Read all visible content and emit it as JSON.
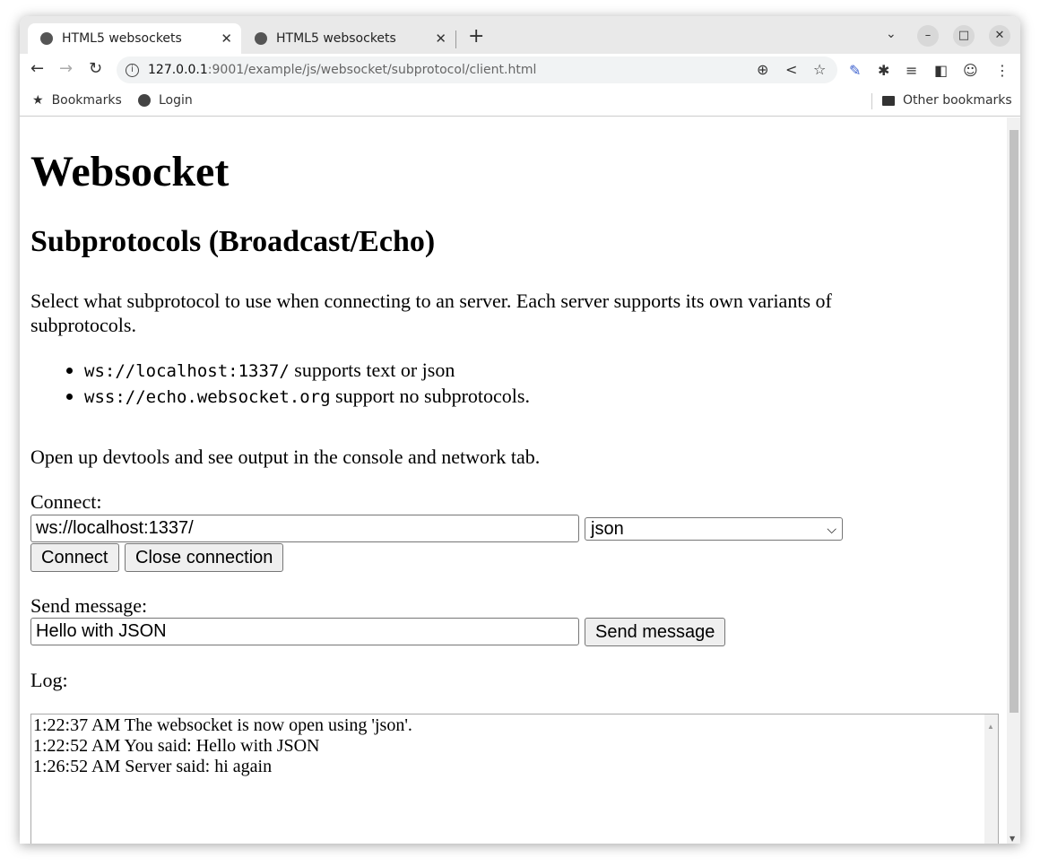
{
  "browser": {
    "tabs": [
      {
        "title": "HTML5 websockets",
        "active": true
      },
      {
        "title": "HTML5 websockets",
        "active": false
      }
    ],
    "url_host": "127.0.0.1",
    "url_rest": ":9001/example/js/websocket/subprotocol/client.html",
    "bookmarks": [
      {
        "label": "Bookmarks",
        "icon": "star-icon"
      },
      {
        "label": "Login",
        "icon": "globe-icon"
      }
    ],
    "other_bookmarks": "Other bookmarks"
  },
  "page": {
    "title": "Websocket",
    "subtitle": "Subprotocols (Broadcast/Echo)",
    "intro": "Select what subprotocol to use when connecting to an server. Each server supports its own variants of subprotocols.",
    "servers": [
      {
        "url": "ws://localhost:1337/",
        "desc": " supports text or json"
      },
      {
        "url": "wss://echo.websocket.org",
        "desc": " support no subprotocols."
      }
    ],
    "devtools_note": "Open up devtools and see output in the console and network tab.",
    "connect_label": "Connect:",
    "connect_url": "ws://localhost:1337/",
    "protocol_selected": "json",
    "connect_button": "Connect",
    "close_button": "Close connection",
    "send_label": "Send message:",
    "message_value": "Hello with JSON",
    "send_button": "Send message",
    "log_label": "Log:",
    "log_lines": [
      "1:22:37 AM The websocket is now open using 'json'.",
      "1:22:52 AM You said: Hello with JSON",
      "1:26:52 AM Server said: hi again"
    ]
  }
}
